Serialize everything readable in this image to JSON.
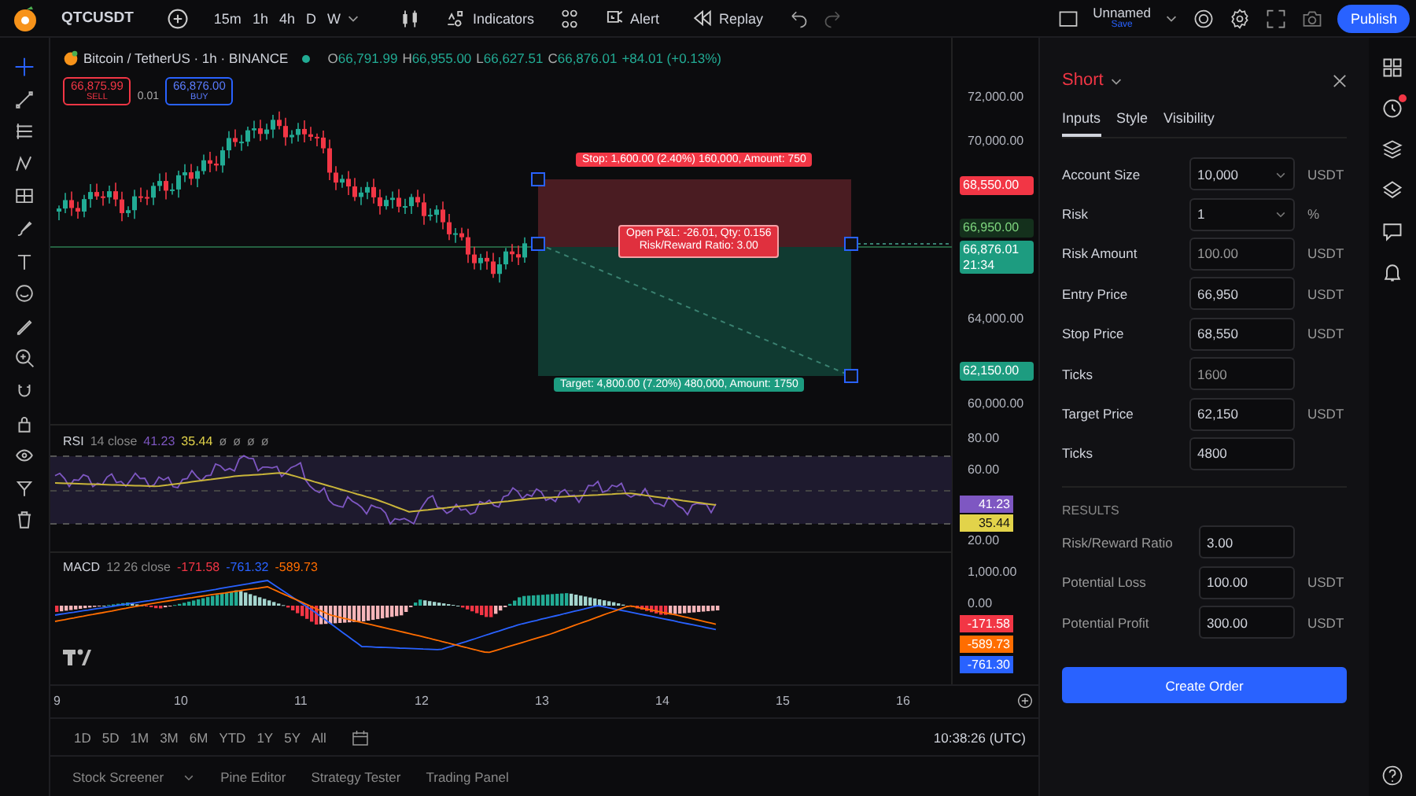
{
  "top_bar": {
    "symbol": "QTCUSDT",
    "timeframes": [
      "15m",
      "1h",
      "4h",
      "D",
      "W"
    ],
    "buttons": [
      {
        "label": "Indicators",
        "kind": "indicators"
      },
      {
        "label": "Alert",
        "kind": "alert"
      },
      {
        "label": "Replay",
        "kind": "replay"
      }
    ],
    "layout_name": "Unnamed",
    "layout_status": "Save",
    "publish": "Publish"
  },
  "legend": {
    "title": "Bitcoin / TetherUS · 1h · BINANCE",
    "ohlc": [
      {
        "key": "O",
        "value": "66,791.99"
      },
      {
        "key": "H",
        "value": "66,955.00"
      },
      {
        "key": "L",
        "value": "66,627.51"
      },
      {
        "key": "C",
        "value": "66,876.01"
      }
    ],
    "change": "+84.01 (+0.13%)"
  },
  "trade": {
    "sell_price": "66,875.99",
    "sell": "SELL",
    "spread": "0.01",
    "buy_price": "66,876.00",
    "buy": "BUY"
  },
  "position": {
    "stop_label": "Stop: 1,600.00 (2.40%) 160,000, Amount: 750",
    "pnl_label": "Open P&L: -26.01, Qty: 0.156",
    "ratio_label": "Risk/Reward Ratio: 3.00",
    "target_label": "Target: 4,800.00 (7.20%) 480,000, Amount: 1750"
  },
  "price_axis": {
    "ticks": [
      "72,000.00",
      "70,000.00",
      "64,000.00",
      "60,000.00"
    ],
    "markers": [
      {
        "text": "68,550.00",
        "kind": "stop"
      },
      {
        "text": "66,950.00",
        "kind": "entry"
      },
      {
        "text": "66,876.01",
        "sub": "21:34",
        "kind": "last"
      },
      {
        "text": "62,150.00",
        "kind": "target"
      }
    ]
  },
  "rsi": {
    "name": "RSI",
    "params": "14 close",
    "values": [
      {
        "text": "41.23",
        "color": "#7e57c2"
      },
      {
        "text": "35.44",
        "color": "#e2d34a"
      }
    ],
    "extras": [
      "ø",
      "ø",
      "ø",
      "ø"
    ],
    "ticks": [
      "80.00",
      "60.00",
      "20.00"
    ],
    "markers": [
      {
        "text": "41.23",
        "color": "#7e57c2"
      },
      {
        "text": "35.44",
        "color": "#e2d34a"
      }
    ]
  },
  "macd": {
    "name": "MACD",
    "params": "12 26 close",
    "values": [
      {
        "text": "-171.58",
        "color": "#f23645"
      },
      {
        "text": "-761.32",
        "color": "#2962ff"
      },
      {
        "text": "-589.73",
        "color": "#ff6d00"
      }
    ],
    "ticks": [
      "1,000.00",
      "0.00"
    ],
    "markers": [
      {
        "text": "-171.58",
        "color": "#f23645"
      },
      {
        "text": "-589.73",
        "color": "#ff6d00"
      },
      {
        "text": "-761.30",
        "color": "#2962ff"
      }
    ]
  },
  "time_axis": [
    "9",
    "10",
    "11",
    "12",
    "13",
    "14",
    "15",
    "16"
  ],
  "ranges": [
    "1D",
    "5D",
    "1M",
    "3M",
    "6M",
    "YTD",
    "1Y",
    "5Y",
    "All"
  ],
  "clock": "10:38:26 (UTC)",
  "bottom_tabs": [
    {
      "label": "Stock Screener",
      "menu": true
    },
    {
      "label": "Pine Editor",
      "menu": false
    },
    {
      "label": "Strategy Tester",
      "menu": false
    },
    {
      "label": "Trading Panel",
      "menu": false
    }
  ],
  "panel": {
    "title": "Short",
    "tabs": [
      {
        "label": "Inputs",
        "selected": true
      },
      {
        "label": "Style",
        "selected": false
      },
      {
        "label": "Visibility",
        "selected": false
      }
    ],
    "fields": [
      {
        "label": "Account Size",
        "value": "10,000",
        "dropdown": true,
        "unit": "USDT"
      },
      {
        "label": "Risk",
        "value": "1",
        "dropdown": true,
        "unit": "%"
      },
      {
        "label": "Risk Amount",
        "value": "100.00",
        "dropdown": false,
        "unit": "USDT"
      },
      {
        "label": "Entry Price",
        "value": "66,950",
        "dropdown": false,
        "unit": "USDT"
      },
      {
        "label": "Stop Price",
        "value": "68,550",
        "dropdown": false,
        "unit": "USDT"
      },
      {
        "label": "Ticks",
        "value": "1600",
        "dropdown": false
      },
      {
        "label": "Target Price",
        "value": "62,150",
        "dropdown": false,
        "unit": "USDT"
      },
      {
        "label": "Ticks",
        "value": "4800",
        "dropdown": false
      }
    ],
    "results_heading": "RESULTS",
    "results": [
      {
        "label": "Risk/Reward Ratio",
        "value": "3.00"
      },
      {
        "label": "Potential Loss",
        "value": "100.00",
        "unit": "USDT"
      },
      {
        "label": "Potential Profit",
        "value": "300.00",
        "unit": "USDT"
      }
    ],
    "button": "Create Order"
  }
}
